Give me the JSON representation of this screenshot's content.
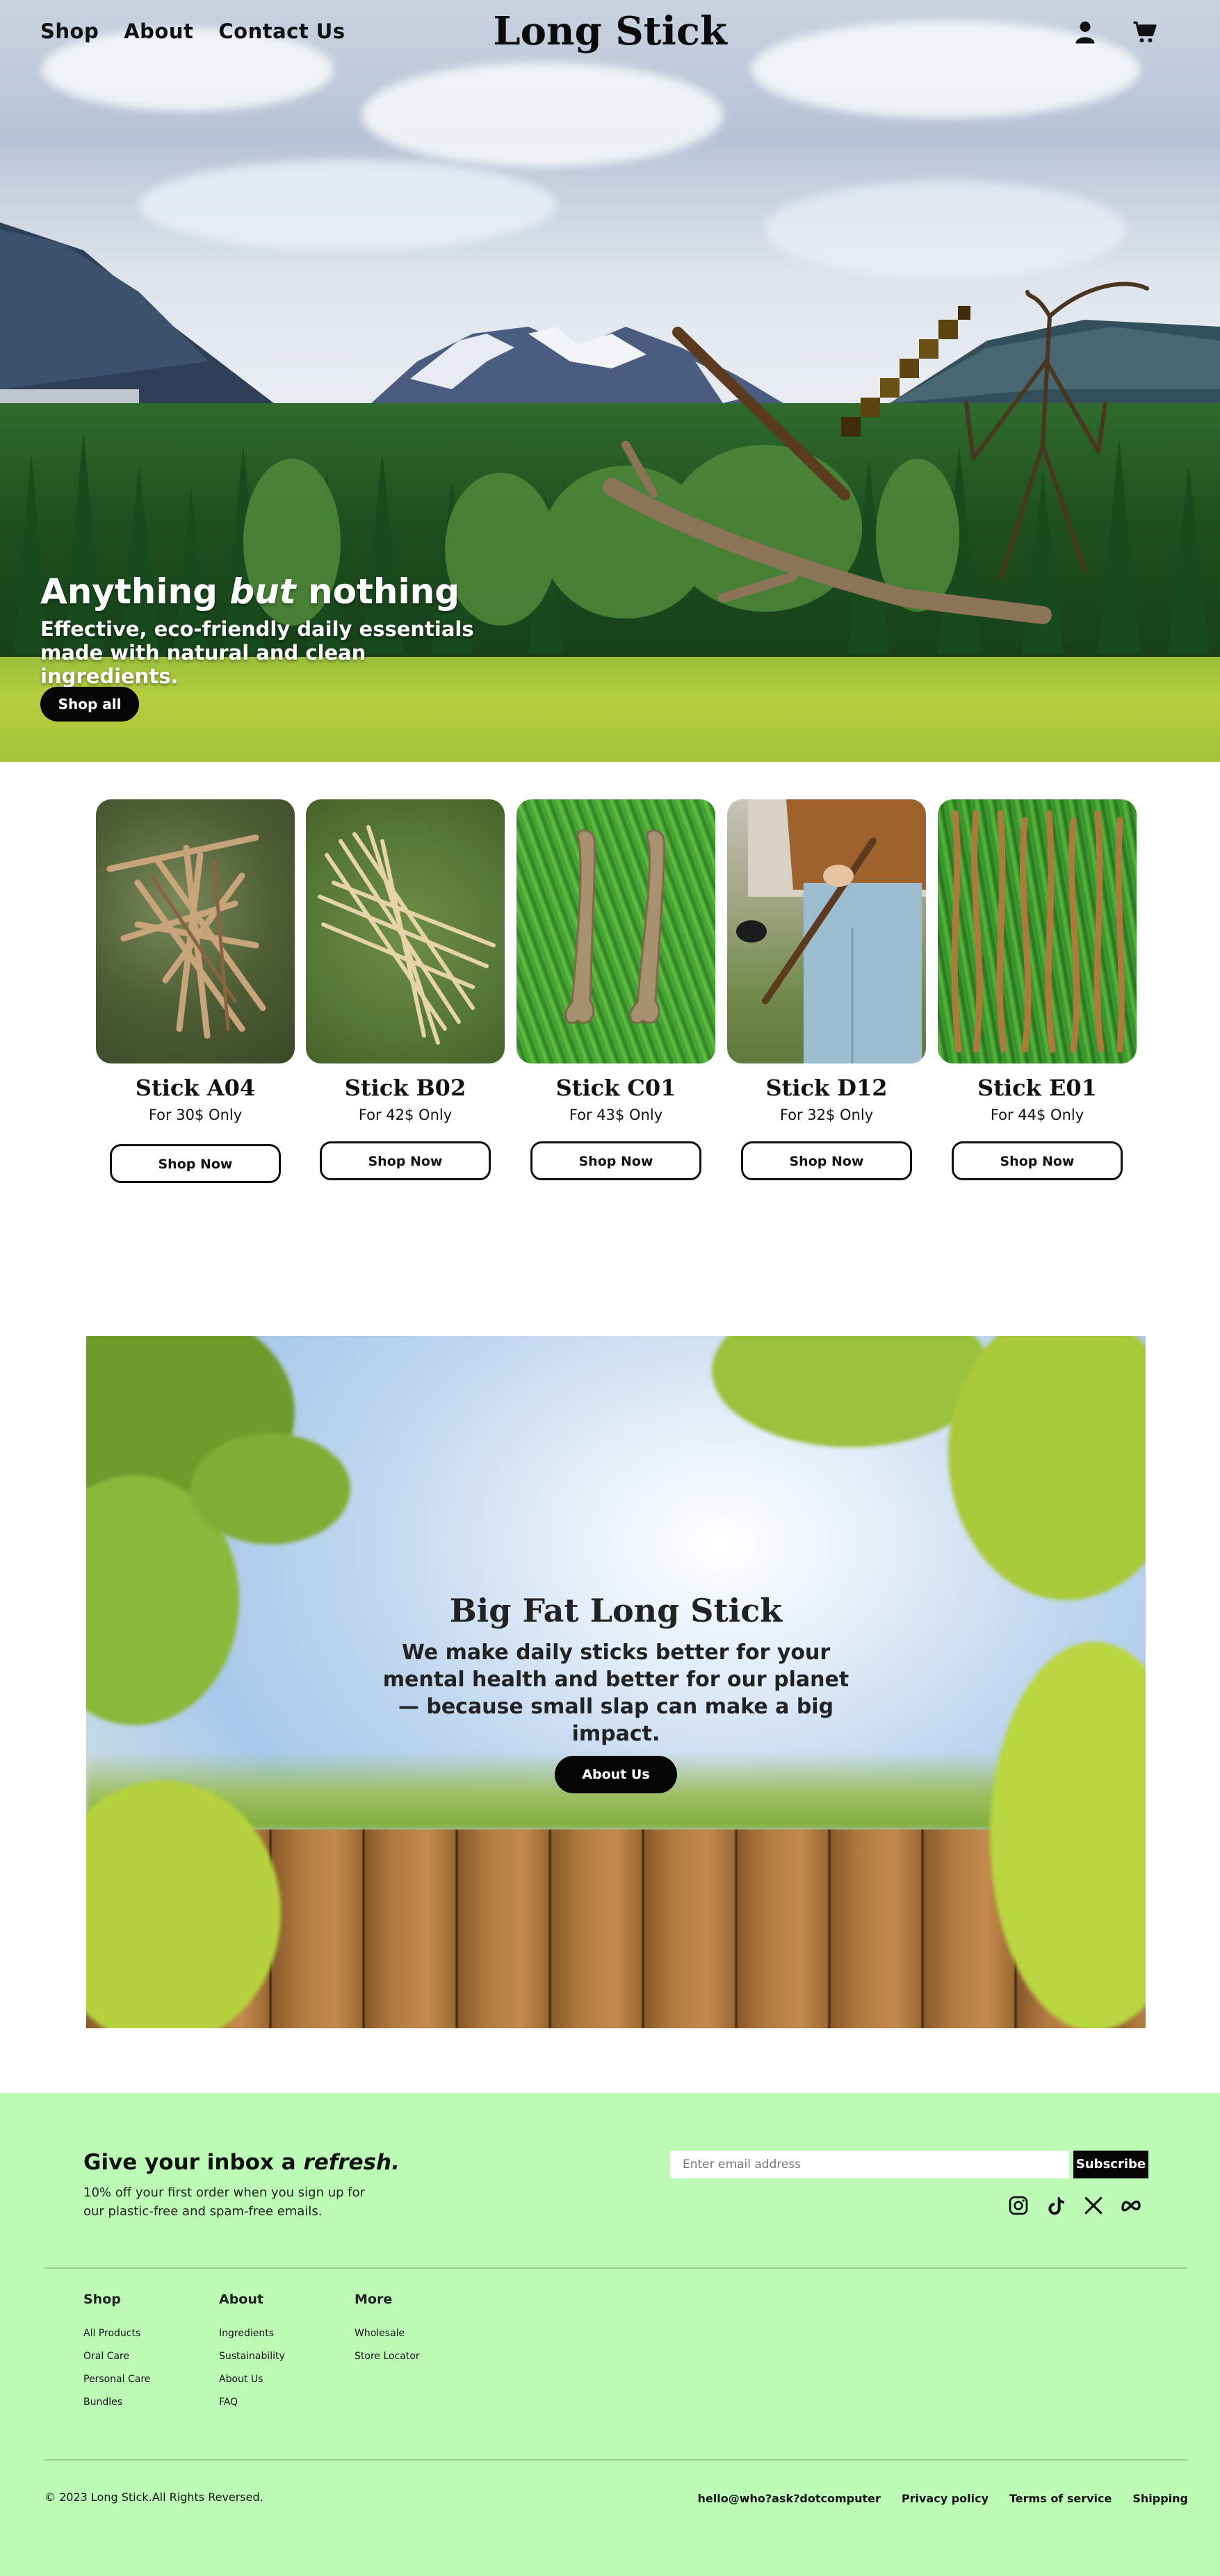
{
  "header": {
    "brand": "Long Stick",
    "nav": [
      "Shop",
      "About",
      "Contact Us"
    ],
    "icons": [
      "account-icon",
      "cart-icon"
    ]
  },
  "hero": {
    "title_pre": "Anything ",
    "title_em": "but",
    "title_post": " nothing",
    "subtitle": "Effective, eco-friendly daily essentials made with natural and clean ingredients.",
    "button": "Shop all"
  },
  "products": [
    {
      "name": "Stick A04",
      "price": "For 30$ Only",
      "button": "Shop Now"
    },
    {
      "name": "Stick B02",
      "price": "For 42$ Only",
      "button": "Shop Now"
    },
    {
      "name": "Stick C01",
      "price": "For 43$ Only",
      "button": "Shop Now"
    },
    {
      "name": "Stick D12",
      "price": "For 32$ Only",
      "button": "Shop Now"
    },
    {
      "name": "Stick E01",
      "price": "For 44$ Only",
      "button": "Shop Now"
    }
  ],
  "banner": {
    "title": "Big Fat Long Stick",
    "text": "We make daily sticks better for your mental health and better for our planet — because small slap can make a big impact.",
    "button": "About Us"
  },
  "footer": {
    "newsletter_pre": "Give your inbox a ",
    "newsletter_em": "refresh.",
    "newsletter_desc": "10% off your first order when you sign up for our plastic-free and spam-free emails.",
    "email_placeholder": "Enter email address",
    "subscribe": "Subscribe",
    "socials": [
      "instagram-icon",
      "tiktok-icon",
      "x-icon",
      "meta-icon"
    ],
    "columns": [
      {
        "heading": "Shop",
        "links": [
          "All Products",
          "Oral Care",
          "Personal Care",
          "Bundles"
        ]
      },
      {
        "heading": "About",
        "links": [
          "Ingredients",
          "Sustainability",
          "About Us",
          "FAQ"
        ]
      },
      {
        "heading": "More",
        "links": [
          "Wholesale",
          "Store Locator"
        ]
      }
    ],
    "copyright": "© 2023 Long Stick.All Rights Reversed.",
    "legal": [
      "hello@who?ask?dotcomputer",
      "Privacy policy",
      "Terms of service",
      "Shipping"
    ]
  },
  "colors": {
    "footer_bg": "#bdfcb6",
    "button_bg": "#050505",
    "text": "#111111"
  }
}
